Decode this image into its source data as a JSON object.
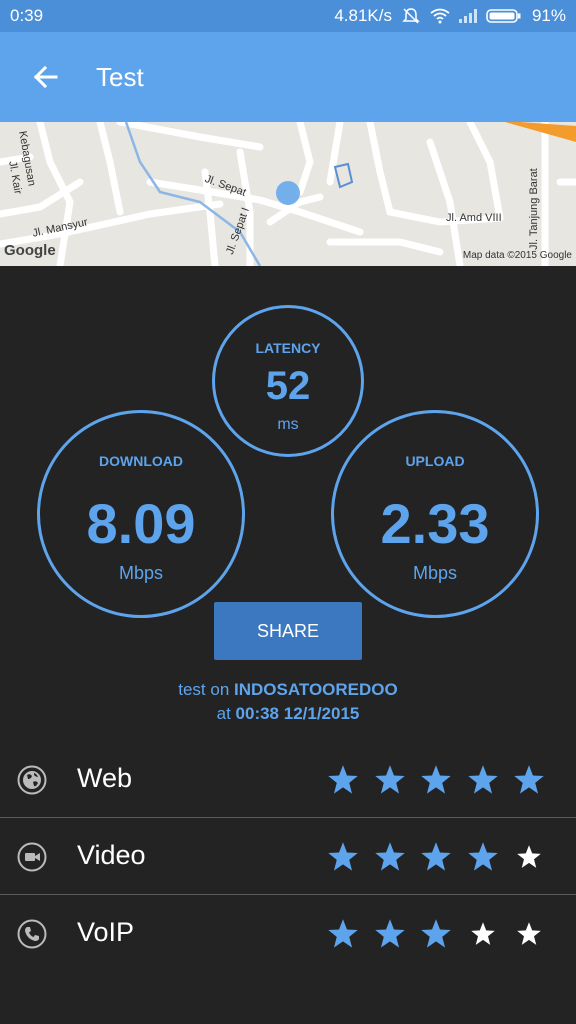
{
  "status": {
    "time": "0:39",
    "net_speed": "4.81K/s",
    "battery": "91%"
  },
  "appbar": {
    "title": "Test",
    "back_icon": "arrow-back-icon"
  },
  "map": {
    "labels": [
      "Kebagusan",
      "Jl. Kair",
      "Jl. Mansyur",
      "Jl. Sepat",
      "Jl. Sepat I",
      "Jl. Amd VIII",
      "Jl. Tanjung Barat"
    ],
    "logo": "Google",
    "attribution": "Map data ©2015 Google"
  },
  "latency": {
    "label": "LATENCY",
    "value": "52",
    "unit": "ms"
  },
  "download": {
    "label": "DOWNLOAD",
    "value": "8.09",
    "unit": "Mbps"
  },
  "upload": {
    "label": "UPLOAD",
    "value": "2.33",
    "unit": "Mbps"
  },
  "share_label": "SHARE",
  "test_info": {
    "prefix": "test on",
    "operator": "INDOSATOOREDOO",
    "at": "at",
    "datetime": "00:38 12/1/2015"
  },
  "ratings": [
    {
      "label": "Web",
      "icon": "globe-icon",
      "stars": 5
    },
    {
      "label": "Video",
      "icon": "video-camera-icon",
      "stars": 4
    },
    {
      "label": "VoIP",
      "icon": "phone-icon",
      "stars": 3
    }
  ],
  "colors": {
    "accent": "#5ea4ec",
    "star_filled": "#5ea4ec",
    "star_empty": "#ffffff",
    "background": "#232323"
  }
}
